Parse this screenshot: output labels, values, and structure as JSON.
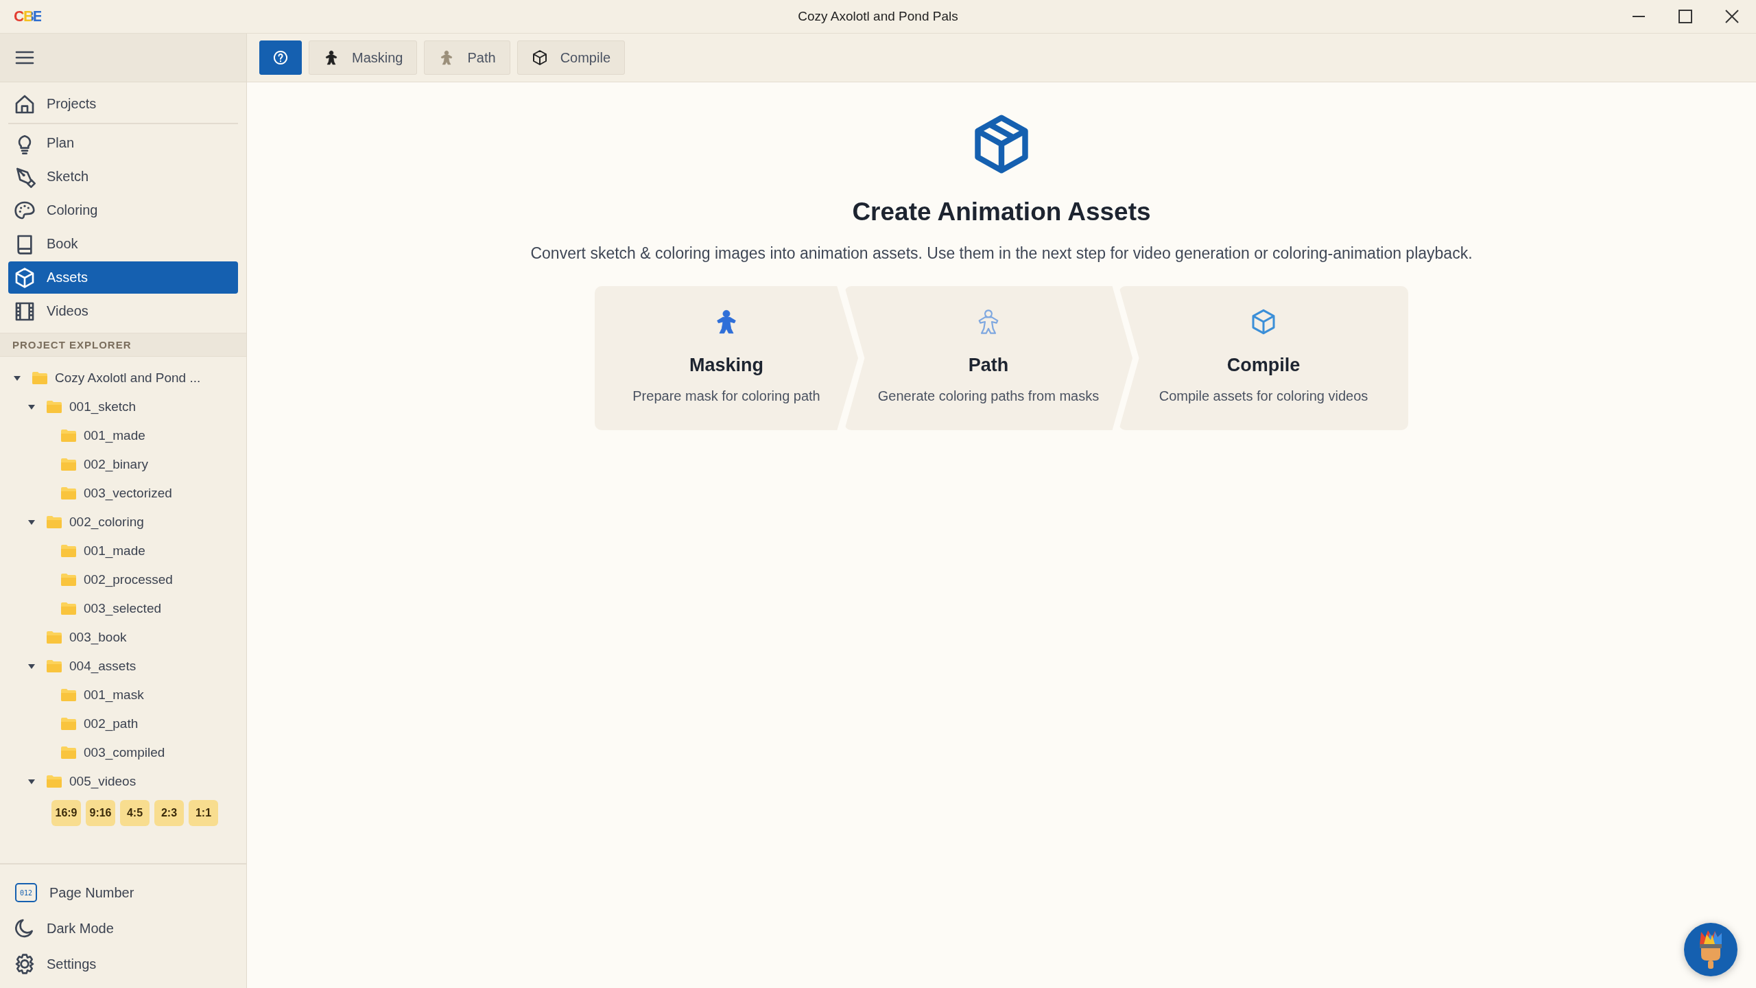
{
  "window": {
    "logo": "CBE",
    "title": "Cozy Axolotl and Pond Pals",
    "controls": [
      {
        "kind": "minimize"
      },
      {
        "kind": "maximize"
      },
      {
        "kind": "close"
      }
    ]
  },
  "toolbar": [
    {
      "kind": "help",
      "selected": true
    },
    {
      "kind": "figure",
      "label": "Masking",
      "selected": false
    },
    {
      "kind": "figure-faded",
      "label": "Path",
      "selected": false
    },
    {
      "kind": "cube",
      "label": "Compile",
      "selected": false
    }
  ],
  "sidebar": {
    "nav": [
      {
        "kind": "home",
        "label": "Projects",
        "selected": false
      },
      {
        "kind": "bulb",
        "label": "Plan",
        "selected": false
      },
      {
        "kind": "pen",
        "label": "Sketch",
        "selected": false
      },
      {
        "kind": "palette",
        "label": "Coloring",
        "selected": false
      },
      {
        "kind": "book",
        "label": "Book",
        "selected": false
      },
      {
        "kind": "cube",
        "label": "Assets",
        "selected": true
      },
      {
        "kind": "film",
        "label": "Videos",
        "selected": false
      }
    ],
    "explorer_title": "PROJECT EXPLORER",
    "tree": [
      {
        "label": "Cozy Axolotl and Pond ...",
        "expanded": true,
        "children": [
          {
            "label": "001_sketch",
            "expanded": true,
            "children": [
              {
                "label": "001_made"
              },
              {
                "label": "002_binary"
              },
              {
                "label": "003_vectorized"
              }
            ]
          },
          {
            "label": "002_coloring",
            "expanded": true,
            "children": [
              {
                "label": "001_made"
              },
              {
                "label": "002_processed"
              },
              {
                "label": "003_selected"
              }
            ]
          },
          {
            "label": "003_book"
          },
          {
            "label": "004_assets",
            "expanded": true,
            "children": [
              {
                "label": "001_mask"
              },
              {
                "label": "002_path"
              },
              {
                "label": "003_compiled"
              }
            ]
          },
          {
            "label": "005_videos",
            "expanded": true,
            "ratios": [
              "16:9",
              "9:16",
              "4:5",
              "2:3",
              "1:1"
            ]
          }
        ]
      }
    ],
    "bottom": [
      {
        "kind": "page-number",
        "label": "Page Number",
        "icon_text": "012"
      },
      {
        "kind": "moon",
        "label": "Dark Mode"
      },
      {
        "kind": "gear",
        "label": "Settings"
      }
    ]
  },
  "main": {
    "title": "Create Animation Assets",
    "description": "Convert sketch & coloring images into animation assets. Use them in the next step for video generation or coloring-animation playback.",
    "steps": [
      {
        "kind": "figure",
        "title": "Masking",
        "subtitle": "Prepare mask for coloring path"
      },
      {
        "kind": "figure-outline",
        "title": "Path",
        "subtitle": "Generate coloring paths from masks"
      },
      {
        "kind": "cube",
        "title": "Compile",
        "subtitle": "Compile assets for coloring videos"
      }
    ]
  }
}
